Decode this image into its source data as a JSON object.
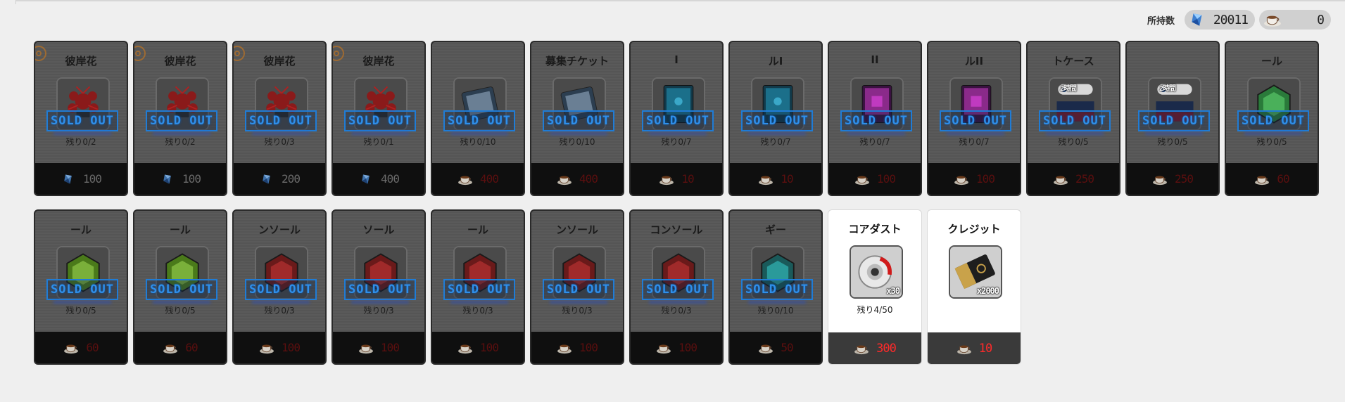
{
  "header": {
    "owned_label": "所持数",
    "gems": "20011",
    "cups": "0"
  },
  "soldout_label": "SOLD OUT",
  "cards": [
    {
      "name": "彼岸花",
      "art": "flower",
      "remain": "残り0/2",
      "price": "100",
      "currency": "gem",
      "sold": true,
      "tag": true
    },
    {
      "name": "彼岸花",
      "art": "flower",
      "remain": "残り0/2",
      "price": "100",
      "currency": "gem",
      "sold": true,
      "tag": true
    },
    {
      "name": "彼岸花",
      "art": "flower",
      "remain": "残り0/3",
      "price": "200",
      "currency": "gem",
      "sold": true,
      "tag": true
    },
    {
      "name": "彼岸花",
      "art": "flower",
      "remain": "残り0/1",
      "price": "400",
      "currency": "gem",
      "sold": true,
      "tag": true
    },
    {
      "name": "",
      "art": "ticket",
      "remain": "残り0/10",
      "price": "400",
      "currency": "cup",
      "sold": true
    },
    {
      "name": "募集チケット",
      "art": "ticket",
      "remain": "残り0/10",
      "price": "400",
      "currency": "cup",
      "sold": true
    },
    {
      "name": "I",
      "art": "console-blue",
      "remain": "残り0/7",
      "price": "10",
      "currency": "cup",
      "sold": true
    },
    {
      "name": "ルI",
      "art": "console-blue",
      "remain": "残り0/7",
      "price": "10",
      "currency": "cup",
      "sold": true
    },
    {
      "name": "II",
      "art": "console-pink",
      "remain": "残り0/7",
      "price": "100",
      "currency": "cup",
      "sold": true
    },
    {
      "name": "ルII",
      "art": "console-pink",
      "remain": "残り0/7",
      "price": "100",
      "currency": "cup",
      "sold": true
    },
    {
      "name": "トケース",
      "art": "case",
      "remain": "残り0/5",
      "price": "250",
      "currency": "cup",
      "sold": true,
      "timer": "2時間"
    },
    {
      "name": "",
      "art": "case",
      "remain": "残り0/5",
      "price": "250",
      "currency": "cup",
      "sold": true,
      "timer": "2時間"
    },
    {
      "name": "ール",
      "art": "hex-green",
      "remain": "残り0/5",
      "price": "60",
      "currency": "cup",
      "sold": true
    },
    {
      "name": "ール",
      "art": "hex-lime",
      "remain": "残り0/5",
      "price": "60",
      "currency": "cup",
      "sold": true
    },
    {
      "name": "ール",
      "art": "hex-lime",
      "remain": "残り0/5",
      "price": "60",
      "currency": "cup",
      "sold": true
    },
    {
      "name": "ンソール",
      "art": "hex-red",
      "remain": "残り0/3",
      "price": "100",
      "currency": "cup",
      "sold": true
    },
    {
      "name": "ソール",
      "art": "hex-red",
      "remain": "残り0/3",
      "price": "100",
      "currency": "cup",
      "sold": true
    },
    {
      "name": "ール",
      "art": "hex-red",
      "remain": "残り0/3",
      "price": "100",
      "currency": "cup",
      "sold": true
    },
    {
      "name": "ンソール",
      "art": "hex-red",
      "remain": "残り0/3",
      "price": "100",
      "currency": "cup",
      "sold": true
    },
    {
      "name": "コンソール",
      "art": "hex-red",
      "remain": "残り0/3",
      "price": "100",
      "currency": "cup",
      "sold": true
    },
    {
      "name": "ギー",
      "art": "hex-teal",
      "remain": "残り0/10",
      "price": "50",
      "currency": "cup",
      "sold": true
    },
    {
      "name": "コアダスト",
      "art": "core",
      "remain": "残り4/50",
      "price": "300",
      "currency": "cup",
      "sold": false,
      "qty": "x30"
    },
    {
      "name": "クレジット",
      "art": "credit",
      "remain": "",
      "price": "10",
      "currency": "cup",
      "sold": false,
      "qty": "x2000"
    }
  ],
  "colors": {
    "soldout_blue": "#2f8fea",
    "price_red": "#ff2a2a",
    "bg": "#efefef"
  }
}
